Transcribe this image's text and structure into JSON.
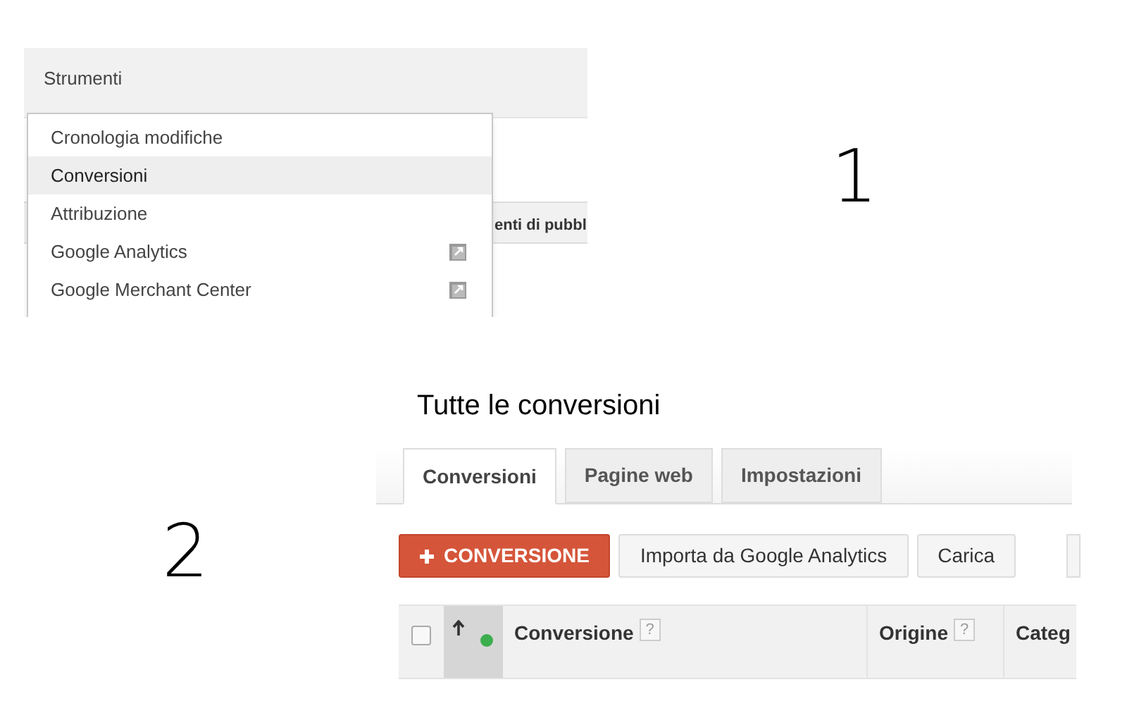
{
  "step_labels": [
    "1",
    "2"
  ],
  "panel_1": {
    "toolbar": {
      "title": "Strumenti"
    },
    "background_header_fragment": "enti di pubbl",
    "menu": [
      {
        "label": "Cronologia modifiche",
        "selected": false,
        "external": false
      },
      {
        "label": "Conversioni",
        "selected": true,
        "external": false
      },
      {
        "label": "Attribuzione",
        "selected": false,
        "external": false
      },
      {
        "label": "Google Analytics",
        "selected": false,
        "external": true
      },
      {
        "label": "Google Merchant Center",
        "selected": false,
        "external": true
      }
    ]
  },
  "panel_2": {
    "title": "Tutte le conversioni",
    "tabs": [
      {
        "label": "Conversioni",
        "selected": true
      },
      {
        "label": "Pagine web",
        "selected": false
      },
      {
        "label": "Impostazioni",
        "selected": false
      }
    ],
    "buttons": [
      {
        "label": "CONVERSIONE",
        "kind": "primary"
      },
      {
        "label": "Importa da Google Analytics",
        "kind": "default"
      },
      {
        "label": "Carica",
        "kind": "default"
      }
    ],
    "table": {
      "select_all_checked": false,
      "columns": [
        {
          "label": "Conversione",
          "help": "?"
        },
        {
          "label": "Origine",
          "help": "?"
        },
        {
          "label": "Categ"
        }
      ]
    }
  }
}
